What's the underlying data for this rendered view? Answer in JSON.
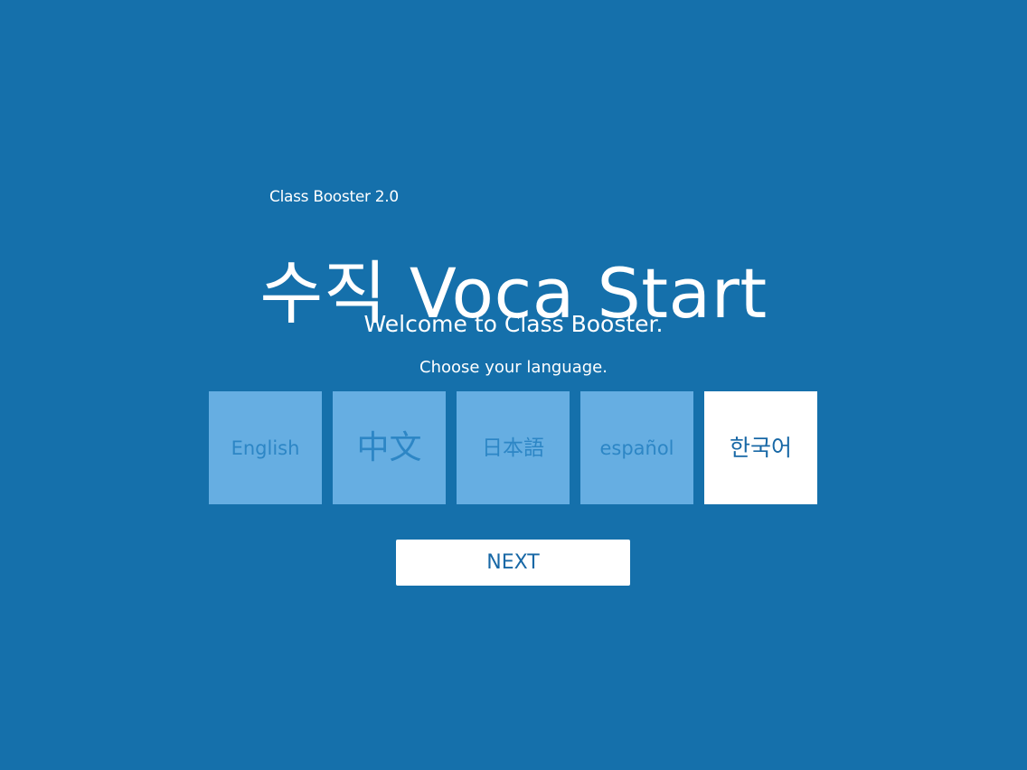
{
  "app": {
    "version_label": "Class Booster 2.0",
    "title": "수직 Voca Start"
  },
  "intro": {
    "welcome": "Welcome to Class Booster.",
    "choose_language": "Choose your language."
  },
  "languages": [
    {
      "label": "English",
      "selected": false
    },
    {
      "label": "中文",
      "selected": false
    },
    {
      "label": "日本語",
      "selected": false
    },
    {
      "label": "español",
      "selected": false
    },
    {
      "label": "한국어",
      "selected": true
    }
  ],
  "actions": {
    "next_label": "NEXT"
  },
  "colors": {
    "background": "#1570ab",
    "tile_unselected": "#66aee2",
    "tile_unselected_text": "#2d86c5",
    "tile_selected": "#ffffff",
    "tile_selected_text": "#1868a6"
  }
}
